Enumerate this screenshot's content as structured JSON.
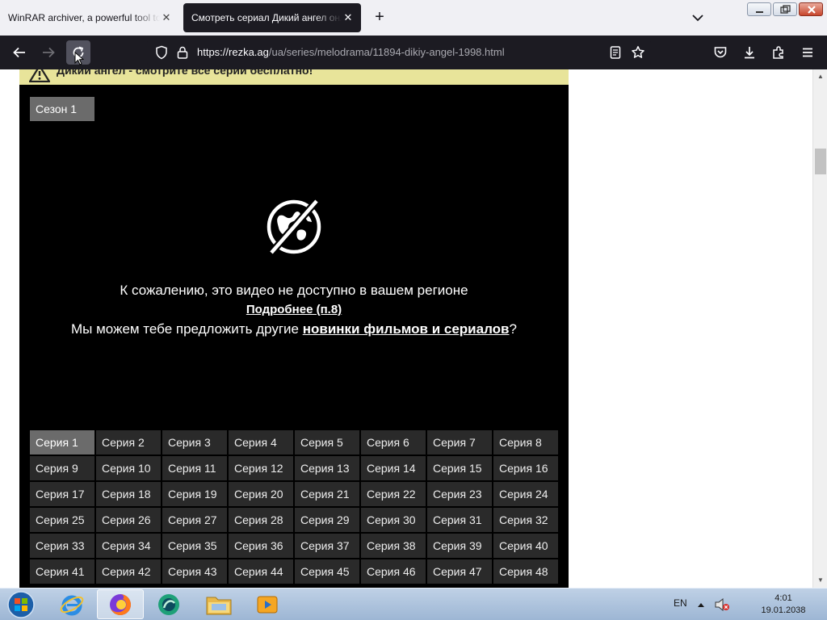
{
  "tabs": [
    {
      "title": "WinRAR archiver, a powerful tool to process RAR and ZIP files",
      "active": false
    },
    {
      "title": "Смотреть сериал Дикий ангел онлайн",
      "active": true
    }
  ],
  "address": {
    "url_domain": "https://rezka.ag",
    "url_path": "/ua/series/melodrama/11894-dikiy-angel-1998.html"
  },
  "page": {
    "notice": "Дикий ангел - смотрите все серии бесплатно!",
    "season_label": "Сезон 1",
    "message_line1": "К сожалению, это видео не доступно в вашем регионе",
    "message_link": "Подробнее (п.8)",
    "message_line3_prefix": "Мы можем тебе предложить другие ",
    "message_line3_link": "новинки фильмов и сериалов",
    "message_line3_suffix": "?",
    "episodes": [
      "Серия 1",
      "Серия 2",
      "Серия 3",
      "Серия 4",
      "Серия 5",
      "Серия 6",
      "Серия 7",
      "Серия 8",
      "Серия 9",
      "Серия 10",
      "Серия 11",
      "Серия 12",
      "Серия 13",
      "Серия 14",
      "Серия 15",
      "Серия 16",
      "Серия 17",
      "Серия 18",
      "Серия 19",
      "Серия 20",
      "Серия 21",
      "Серия 22",
      "Серия 23",
      "Серия 24",
      "Серия 25",
      "Серия 26",
      "Серия 27",
      "Серия 28",
      "Серия 29",
      "Серия 30",
      "Серия 31",
      "Серия 32",
      "Серия 33",
      "Серия 34",
      "Серия 35",
      "Серия 36",
      "Серия 37",
      "Серия 38",
      "Серия 39",
      "Серия 40",
      "Серия 41",
      "Серия 42",
      "Серия 43",
      "Серия 44",
      "Серия 45",
      "Серия 46",
      "Серия 47",
      "Серия 48"
    ],
    "active_episode": "Серия 1"
  },
  "taskbar": {
    "apps": [
      "start-orb",
      "internet-explorer",
      "firefox",
      "app-green",
      "file-explorer",
      "media-player"
    ],
    "lang": "EN",
    "time": "4:01",
    "date": "19.01.2038"
  },
  "colors": {
    "browser_dark": "#1c1b22",
    "notice_bg": "#e8e49a",
    "episode_bg": "#2a2a2a",
    "episode_active_bg": "#6b6b6b"
  }
}
